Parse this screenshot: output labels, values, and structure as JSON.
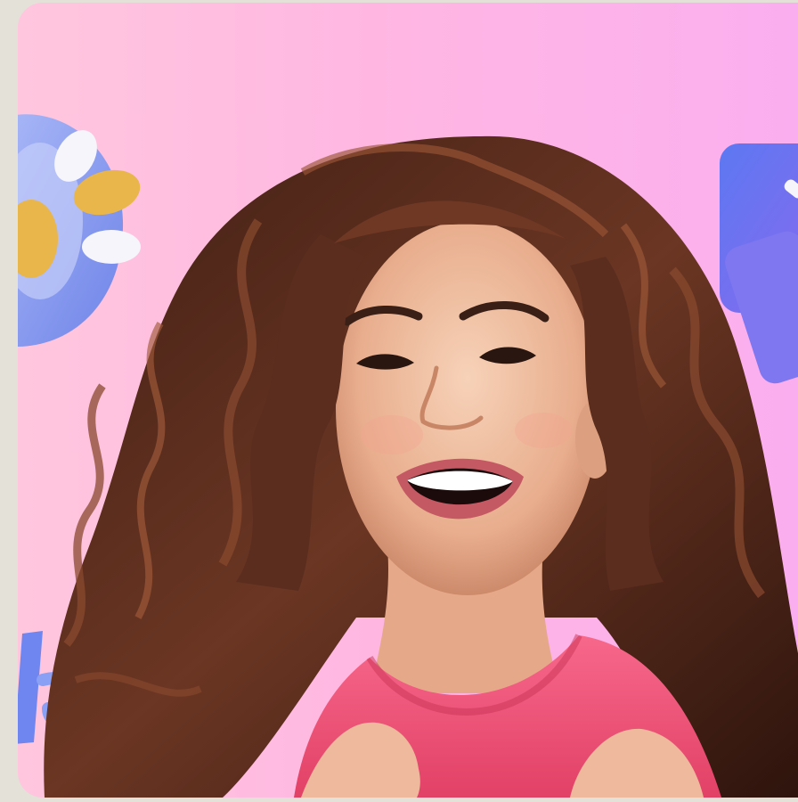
{
  "image": {
    "alt": "",
    "colors": {
      "background_left": "#ffc6de",
      "background_right": "#fbaeef",
      "page_margin": "#e4e1d9",
      "hair": "#5a2e1f",
      "skin": "#f2c4a8",
      "hoodie": "#f2577b",
      "decor_blue": "#8ea3f2",
      "decor_yellow": "#e8b64a",
      "decor_white": "#f5f5fb",
      "decor_purple": "#7f77f0"
    },
    "icons": {
      "left_decor": "3d-abstract-shape-icon",
      "right_decor": "3d-purple-card-icon",
      "bottom_left_decor": "3d-blue-letter-icon"
    }
  }
}
